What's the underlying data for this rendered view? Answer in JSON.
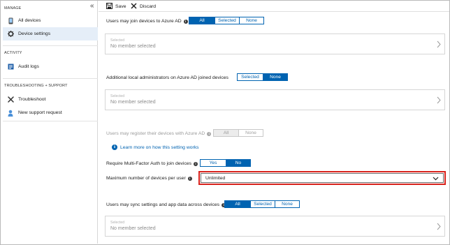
{
  "sidebar": {
    "collapse_glyph": "«",
    "sections": [
      {
        "title": "MANAGE"
      },
      {
        "title": "ACTIVITY"
      },
      {
        "title": "TROUBLESHOOTING + SUPPORT"
      }
    ],
    "items": [
      {
        "label": "All devices",
        "icon": "device-phone-icon",
        "active": false
      },
      {
        "label": "Device settings",
        "icon": "gear-icon",
        "active": true
      },
      {
        "label": "Audit logs",
        "icon": "audit-log-icon",
        "active": false
      },
      {
        "label": "Troubleshoot",
        "icon": "wrench-icon",
        "active": false
      },
      {
        "label": "New support request",
        "icon": "support-person-icon",
        "active": false
      }
    ]
  },
  "toolbar": {
    "save_label": "Save",
    "discard_label": "Discard"
  },
  "settings": {
    "join": {
      "label": "Users may join devices to Azure AD",
      "options": [
        "All",
        "Selected",
        "None"
      ],
      "selected": "All",
      "member_small": "Selected",
      "member_main": "No member selected"
    },
    "local_admins": {
      "label": "Additional local administrators on Azure AD joined devices",
      "options": [
        "Selected",
        "None"
      ],
      "selected": "None",
      "member_small": "Selected",
      "member_main": "No member selected"
    },
    "register": {
      "label": "Users may register their devices with Azure AD",
      "options": [
        "All",
        "None"
      ],
      "selected": "All",
      "disabled": true,
      "link": "Learn more on how this setting works"
    },
    "mfa": {
      "label": "Require Multi-Factor Auth to join devices",
      "options": [
        "Yes",
        "No"
      ],
      "selected": "No"
    },
    "max_devices": {
      "label": "Maximum number of devices per user",
      "value": "Unlimited",
      "highlight_color": "#d9231d"
    },
    "sync": {
      "label": "Users may sync settings and app data across devices",
      "options": [
        "All",
        "Selected",
        "None"
      ],
      "selected": "All",
      "member_small": "Selected",
      "member_main": "No member selected"
    }
  },
  "colors": {
    "accent": "#0063b1",
    "active_nav_bg": "#e5eef8",
    "highlight": "#d9231d"
  }
}
